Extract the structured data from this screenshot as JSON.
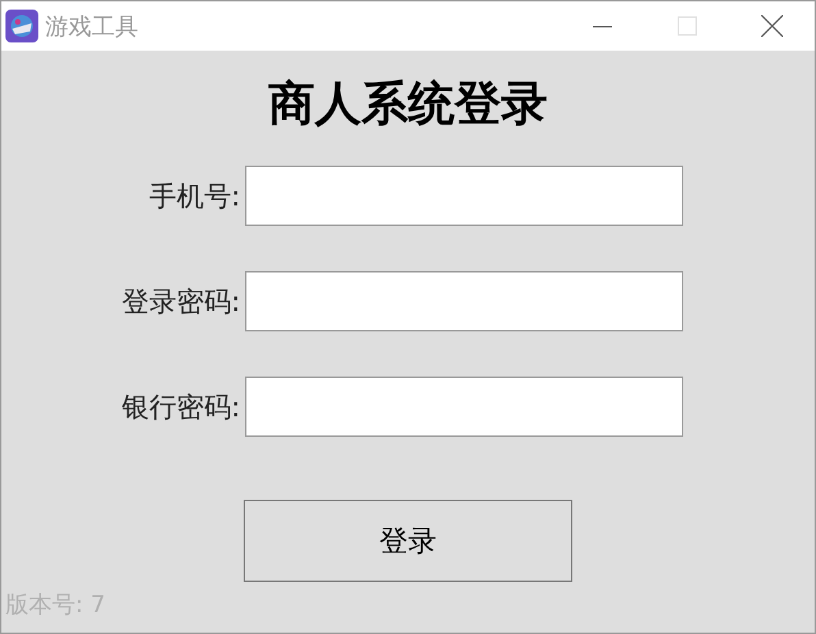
{
  "window": {
    "title": "游戏工具",
    "maximize_disabled": true
  },
  "heading": "商人系统登录",
  "fields": [
    {
      "label": "手机号:"
    },
    {
      "label": "登录密码:"
    },
    {
      "label": "银行密码:"
    }
  ],
  "login_button": "登录",
  "version": "版本号: 7"
}
